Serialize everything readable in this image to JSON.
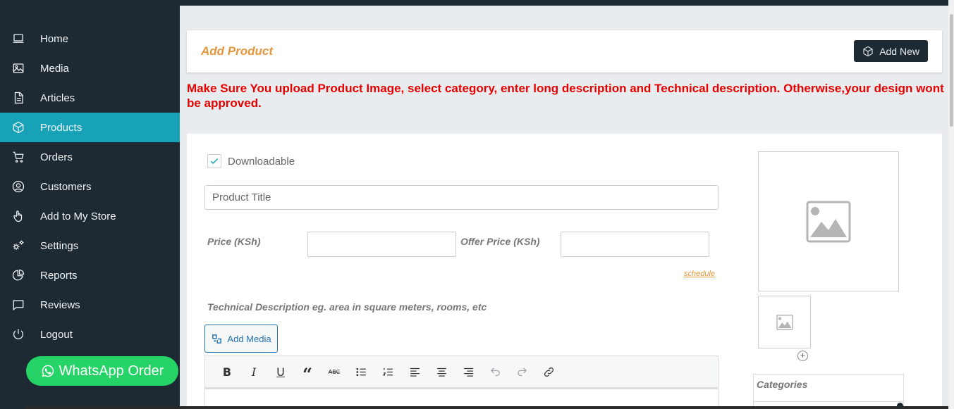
{
  "sidebar": {
    "items": [
      {
        "label": "Home",
        "icon": "laptop-icon",
        "active": false
      },
      {
        "label": "Media",
        "icon": "image-icon",
        "active": false
      },
      {
        "label": "Articles",
        "icon": "document-icon",
        "active": false
      },
      {
        "label": "Products",
        "icon": "box-icon",
        "active": true
      },
      {
        "label": "Orders",
        "icon": "cart-icon",
        "active": false
      },
      {
        "label": "Customers",
        "icon": "user-circle-icon",
        "active": false
      },
      {
        "label": "Add to My Store",
        "icon": "hand-pointer-icon",
        "active": false
      },
      {
        "label": "Settings",
        "icon": "cogs-icon",
        "active": false
      },
      {
        "label": "Reports",
        "icon": "pie-chart-icon",
        "active": false
      },
      {
        "label": "Reviews",
        "icon": "comment-icon",
        "active": false
      },
      {
        "label": "Logout",
        "icon": "power-icon",
        "active": false
      }
    ],
    "whatsapp_label": "WhatsApp Order"
  },
  "header": {
    "title": "Add Product",
    "add_new_label": "Add New"
  },
  "warning": "Make Sure You upload Product Image, select category, enter long description and Technical description. Otherwise,your design wont be approved.",
  "form": {
    "downloadable_label": "Downloadable",
    "downloadable_checked": true,
    "title_placeholder": "Product Title",
    "price_label": "Price (KSh)",
    "offer_price_label": "Offer Price (KSh)",
    "schedule_label": "schedule",
    "tech_desc_label": "Technical Description eg. area in square meters, rooms, etc",
    "add_media_label": "Add Media",
    "categories_label": "Categories"
  },
  "colors": {
    "sidebar_bg": "#1e2a33",
    "active_bg": "#17a2b8",
    "accent": "#e6963a",
    "warning": "#e60000",
    "whatsapp": "#25d366"
  }
}
